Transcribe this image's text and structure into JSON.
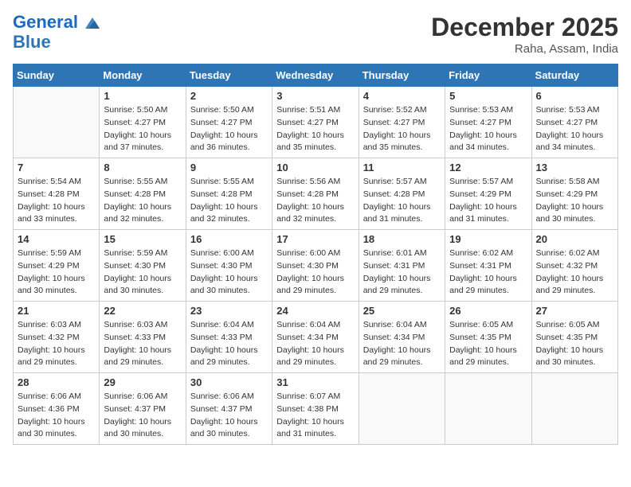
{
  "header": {
    "logo_line1": "General",
    "logo_line2": "Blue",
    "month_title": "December 2025",
    "location": "Raha, Assam, India"
  },
  "days_of_week": [
    "Sunday",
    "Monday",
    "Tuesday",
    "Wednesday",
    "Thursday",
    "Friday",
    "Saturday"
  ],
  "weeks": [
    [
      {
        "day": "",
        "info": ""
      },
      {
        "day": "1",
        "info": "Sunrise: 5:50 AM\nSunset: 4:27 PM\nDaylight: 10 hours\nand 37 minutes."
      },
      {
        "day": "2",
        "info": "Sunrise: 5:50 AM\nSunset: 4:27 PM\nDaylight: 10 hours\nand 36 minutes."
      },
      {
        "day": "3",
        "info": "Sunrise: 5:51 AM\nSunset: 4:27 PM\nDaylight: 10 hours\nand 35 minutes."
      },
      {
        "day": "4",
        "info": "Sunrise: 5:52 AM\nSunset: 4:27 PM\nDaylight: 10 hours\nand 35 minutes."
      },
      {
        "day": "5",
        "info": "Sunrise: 5:53 AM\nSunset: 4:27 PM\nDaylight: 10 hours\nand 34 minutes."
      },
      {
        "day": "6",
        "info": "Sunrise: 5:53 AM\nSunset: 4:27 PM\nDaylight: 10 hours\nand 34 minutes."
      }
    ],
    [
      {
        "day": "7",
        "info": "Sunrise: 5:54 AM\nSunset: 4:28 PM\nDaylight: 10 hours\nand 33 minutes."
      },
      {
        "day": "8",
        "info": "Sunrise: 5:55 AM\nSunset: 4:28 PM\nDaylight: 10 hours\nand 32 minutes."
      },
      {
        "day": "9",
        "info": "Sunrise: 5:55 AM\nSunset: 4:28 PM\nDaylight: 10 hours\nand 32 minutes."
      },
      {
        "day": "10",
        "info": "Sunrise: 5:56 AM\nSunset: 4:28 PM\nDaylight: 10 hours\nand 32 minutes."
      },
      {
        "day": "11",
        "info": "Sunrise: 5:57 AM\nSunset: 4:28 PM\nDaylight: 10 hours\nand 31 minutes."
      },
      {
        "day": "12",
        "info": "Sunrise: 5:57 AM\nSunset: 4:29 PM\nDaylight: 10 hours\nand 31 minutes."
      },
      {
        "day": "13",
        "info": "Sunrise: 5:58 AM\nSunset: 4:29 PM\nDaylight: 10 hours\nand 30 minutes."
      }
    ],
    [
      {
        "day": "14",
        "info": "Sunrise: 5:59 AM\nSunset: 4:29 PM\nDaylight: 10 hours\nand 30 minutes."
      },
      {
        "day": "15",
        "info": "Sunrise: 5:59 AM\nSunset: 4:30 PM\nDaylight: 10 hours\nand 30 minutes."
      },
      {
        "day": "16",
        "info": "Sunrise: 6:00 AM\nSunset: 4:30 PM\nDaylight: 10 hours\nand 30 minutes."
      },
      {
        "day": "17",
        "info": "Sunrise: 6:00 AM\nSunset: 4:30 PM\nDaylight: 10 hours\nand 29 minutes."
      },
      {
        "day": "18",
        "info": "Sunrise: 6:01 AM\nSunset: 4:31 PM\nDaylight: 10 hours\nand 29 minutes."
      },
      {
        "day": "19",
        "info": "Sunrise: 6:02 AM\nSunset: 4:31 PM\nDaylight: 10 hours\nand 29 minutes."
      },
      {
        "day": "20",
        "info": "Sunrise: 6:02 AM\nSunset: 4:32 PM\nDaylight: 10 hours\nand 29 minutes."
      }
    ],
    [
      {
        "day": "21",
        "info": "Sunrise: 6:03 AM\nSunset: 4:32 PM\nDaylight: 10 hours\nand 29 minutes."
      },
      {
        "day": "22",
        "info": "Sunrise: 6:03 AM\nSunset: 4:33 PM\nDaylight: 10 hours\nand 29 minutes."
      },
      {
        "day": "23",
        "info": "Sunrise: 6:04 AM\nSunset: 4:33 PM\nDaylight: 10 hours\nand 29 minutes."
      },
      {
        "day": "24",
        "info": "Sunrise: 6:04 AM\nSunset: 4:34 PM\nDaylight: 10 hours\nand 29 minutes."
      },
      {
        "day": "25",
        "info": "Sunrise: 6:04 AM\nSunset: 4:34 PM\nDaylight: 10 hours\nand 29 minutes."
      },
      {
        "day": "26",
        "info": "Sunrise: 6:05 AM\nSunset: 4:35 PM\nDaylight: 10 hours\nand 29 minutes."
      },
      {
        "day": "27",
        "info": "Sunrise: 6:05 AM\nSunset: 4:35 PM\nDaylight: 10 hours\nand 30 minutes."
      }
    ],
    [
      {
        "day": "28",
        "info": "Sunrise: 6:06 AM\nSunset: 4:36 PM\nDaylight: 10 hours\nand 30 minutes."
      },
      {
        "day": "29",
        "info": "Sunrise: 6:06 AM\nSunset: 4:37 PM\nDaylight: 10 hours\nand 30 minutes."
      },
      {
        "day": "30",
        "info": "Sunrise: 6:06 AM\nSunset: 4:37 PM\nDaylight: 10 hours\nand 30 minutes."
      },
      {
        "day": "31",
        "info": "Sunrise: 6:07 AM\nSunset: 4:38 PM\nDaylight: 10 hours\nand 31 minutes."
      },
      {
        "day": "",
        "info": ""
      },
      {
        "day": "",
        "info": ""
      },
      {
        "day": "",
        "info": ""
      }
    ]
  ]
}
